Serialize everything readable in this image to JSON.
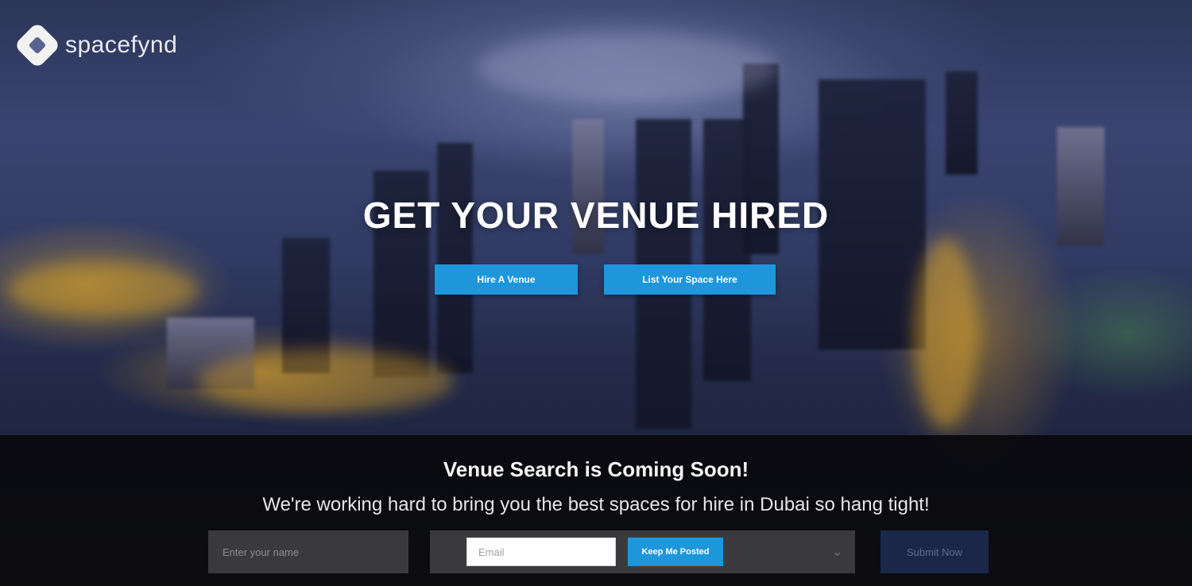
{
  "brand": {
    "name": "spacefynd",
    "logo_icon": "spacefynd-logo-icon"
  },
  "hero": {
    "title": "GET YOUR VENUE HIRED",
    "primary_button": "Hire A Venue",
    "secondary_button": "List Your Space Here"
  },
  "banner": {
    "title": "Venue Search is Coming Soon!",
    "subtitle": "We're working hard to bring you the best spaces for hire in Dubai so hang tight!",
    "name_placeholder": "Enter your name",
    "email_placeholder": "Email",
    "keep_button": "Keep Me Posted",
    "submit_button": "Submit Now"
  },
  "colors": {
    "accent": "#1e96dc",
    "banner_bg": "#0c0c10",
    "submit_bg": "#1b2749"
  }
}
